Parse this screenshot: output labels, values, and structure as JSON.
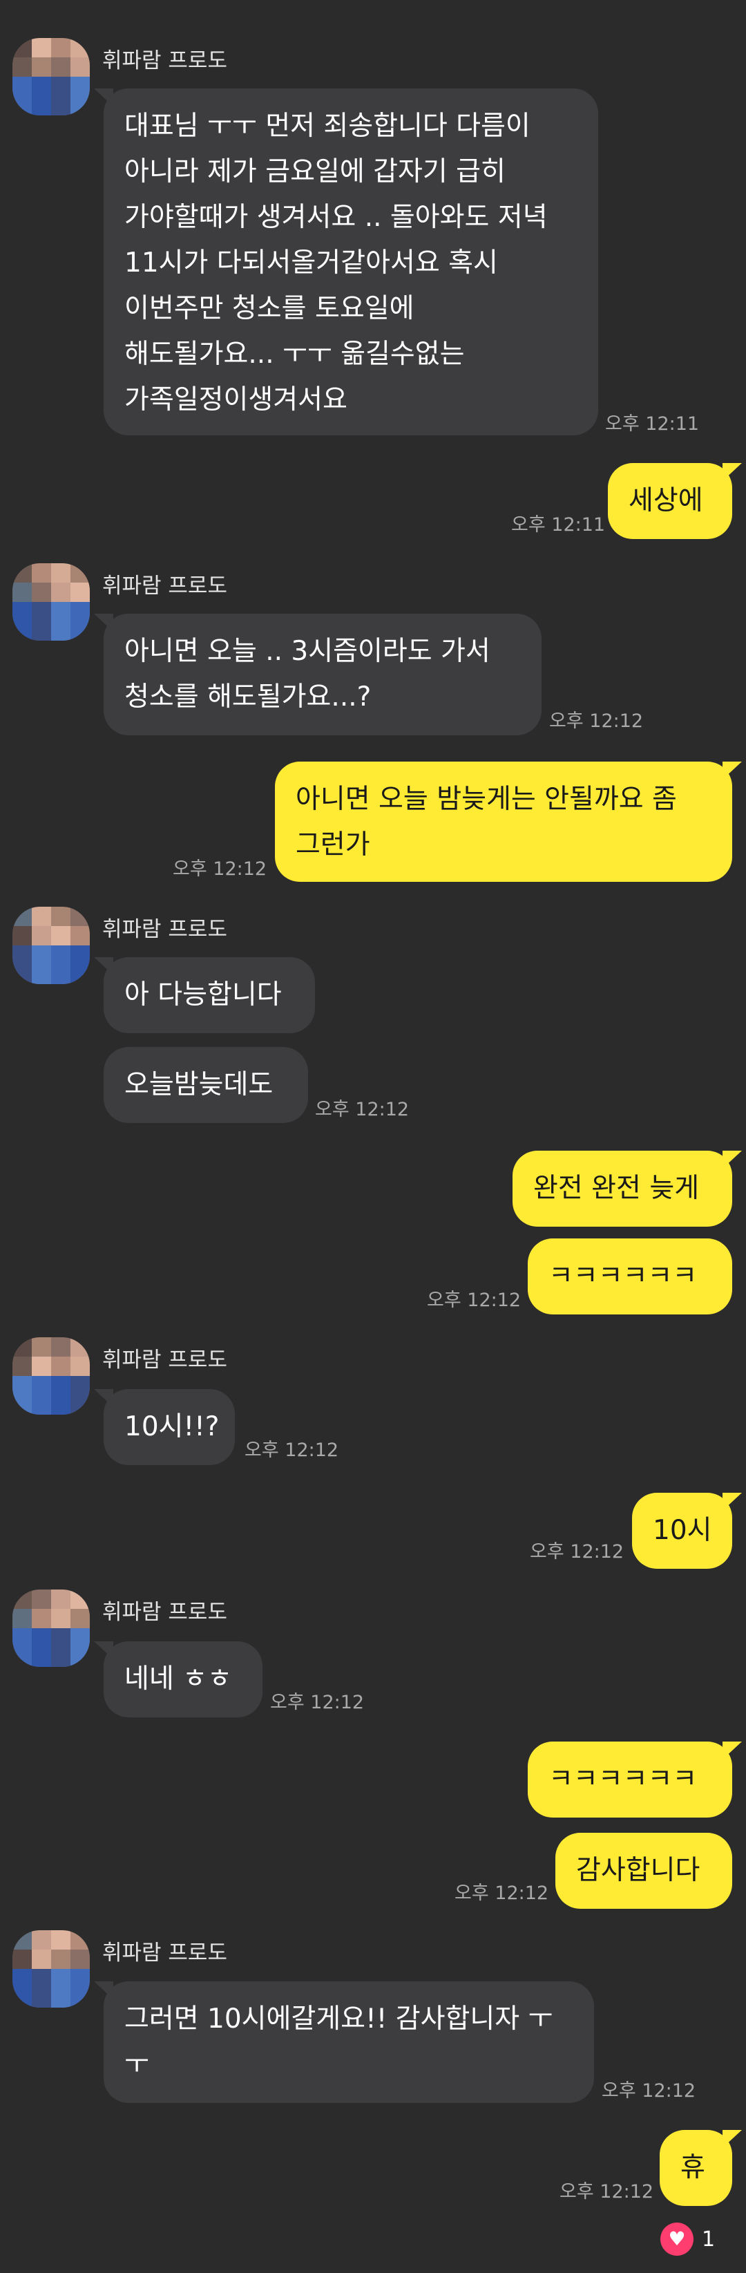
{
  "colors": {
    "background": "#2b2b2c",
    "received_bubble": "#3d3d3f",
    "sent_bubble": "#ffeb33",
    "reaction_heart": "#ff3d6e"
  },
  "sender_name": "휘파람 프로도",
  "messages": [
    {
      "id": 1,
      "dir": "in",
      "lines": [
        "대표님 ㅜㅜ 먼저 죄송합니다 다름이",
        "아니라 제가 금요일에 갑자기 급히",
        "가야할때가 생겨서요 .. 돌아와도 저녁",
        "11시가 다되서올거같아서요 혹시",
        "이번주만 청소를 토요일에",
        "해도될가요... ㅜㅜ 옮길수없는",
        "가족일정이생겨서요"
      ],
      "time": "오후 12:11"
    },
    {
      "id": 2,
      "dir": "out",
      "lines": [
        "세상에"
      ],
      "time": "오후 12:11"
    },
    {
      "id": 3,
      "dir": "in",
      "lines": [
        "아니면 오늘 .. 3시즘이라도 가서",
        "청소를 해도될가요...?"
      ],
      "time": "오후 12:12"
    },
    {
      "id": 4,
      "dir": "out",
      "lines": [
        "아니면 오늘 밤늦게는 안될까요 좀",
        "그런가"
      ],
      "time": "오후 12:12"
    },
    {
      "id": 5,
      "dir": "in",
      "lines": [
        "아 다능합니다"
      ],
      "time": ""
    },
    {
      "id": 6,
      "dir": "in",
      "lines": [
        "오늘밤늦데도"
      ],
      "time": "오후 12:12"
    },
    {
      "id": 7,
      "dir": "out",
      "lines": [
        "완전 완전 늦게"
      ],
      "time": ""
    },
    {
      "id": 8,
      "dir": "out",
      "lines": [
        "ㅋㅋㅋㅋㅋㅋ"
      ],
      "time": "오후 12:12"
    },
    {
      "id": 9,
      "dir": "in",
      "lines": [
        "10시!!?"
      ],
      "time": "오후 12:12"
    },
    {
      "id": 10,
      "dir": "out",
      "lines": [
        "10시"
      ],
      "time": "오후 12:12"
    },
    {
      "id": 11,
      "dir": "in",
      "lines": [
        "네네 ㅎㅎ"
      ],
      "time": "오후 12:12"
    },
    {
      "id": 12,
      "dir": "out",
      "lines": [
        "ㅋㅋㅋㅋㅋㅋ"
      ],
      "time": ""
    },
    {
      "id": 13,
      "dir": "out",
      "lines": [
        "감사합니다"
      ],
      "time": "오후 12:12"
    },
    {
      "id": 14,
      "dir": "in",
      "lines": [
        "그러면 10시에갈게요!! 감사합니자 ㅜ",
        "ㅜ"
      ],
      "time": "오후 12:12"
    },
    {
      "id": 15,
      "dir": "out",
      "lines": [
        "휴"
      ],
      "time": "오후 12:12"
    }
  ],
  "reaction": {
    "icon": "heart-icon",
    "count": "1"
  }
}
